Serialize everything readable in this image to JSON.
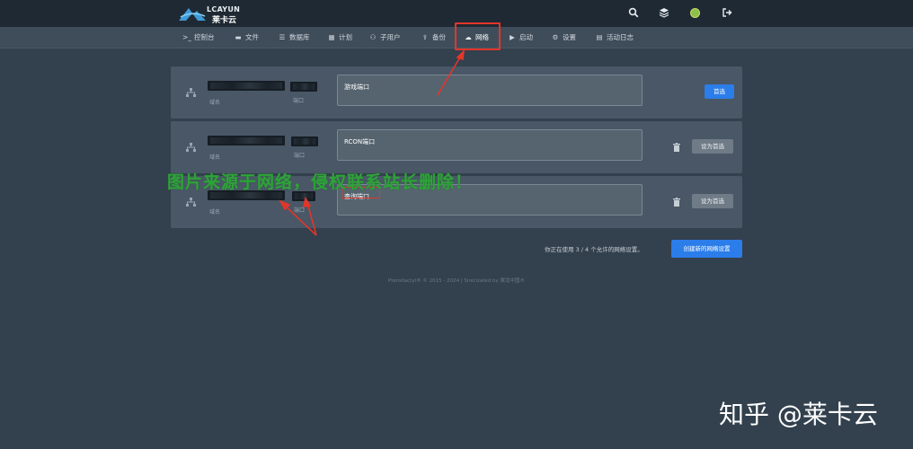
{
  "brand": {
    "name_en": "LCAYUN",
    "name_cn": "莱卡云"
  },
  "topbar": {
    "icons": [
      "search-icon",
      "layers-icon",
      "avatar",
      "logout-icon"
    ]
  },
  "nav": {
    "items": [
      {
        "icon": "terminal-icon",
        "label": "控制台"
      },
      {
        "icon": "folder-icon",
        "label": "文件"
      },
      {
        "icon": "database-icon",
        "label": "数据库"
      },
      {
        "icon": "calendar-icon",
        "label": "计划"
      },
      {
        "icon": "users-icon",
        "label": "子用户"
      },
      {
        "icon": "upload-icon",
        "label": "备份"
      },
      {
        "icon": "cloud-icon",
        "label": "网络"
      },
      {
        "icon": "play-icon",
        "label": "启动"
      },
      {
        "icon": "cogs-icon",
        "label": "设置"
      },
      {
        "icon": "list-icon",
        "label": "活动日志"
      }
    ],
    "active": "网络"
  },
  "allocations": [
    {
      "domain_label": "域名",
      "port_label": "端口",
      "notes": "游戏端口",
      "action": "首选",
      "deletable": false
    },
    {
      "domain_label": "域名",
      "port_label": "端口",
      "notes": "RCON端口",
      "action": "设为首选",
      "deletable": true
    },
    {
      "domain_label": "域名",
      "port_label": "端口",
      "notes": "查询端口",
      "action": "设为首选",
      "deletable": true
    }
  ],
  "usage_text": "你正在使用 3 / 4 个允许的网络设置。",
  "create_button": "创建新的网络设置",
  "copyright": "Pterodactyl® © 2015 - 2024 | Sinicizated by 翼龙中国®",
  "watermark": "图片来源于网络，侵权联系站长删除！",
  "zhihu_credit": "知乎 @莱卡云",
  "colors": {
    "background": "#33404d",
    "topbar": "#1f2933",
    "card": "#495766",
    "primary": "#2b7de9",
    "annotation_red": "#e2362b",
    "watermark_green": "#2fa33a"
  }
}
